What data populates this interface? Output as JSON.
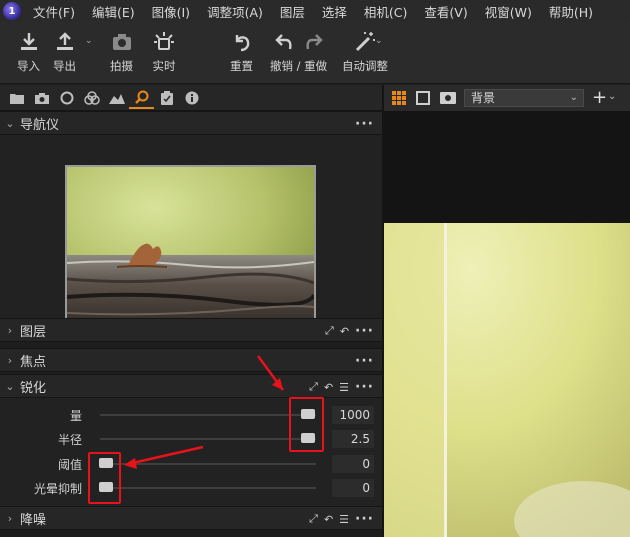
{
  "menu": {
    "items": [
      "文件(F)",
      "编辑(E)",
      "图像(I)",
      "调整项(A)",
      "图层",
      "选择",
      "相机(C)",
      "查看(V)",
      "视窗(W)",
      "帮助(H)"
    ]
  },
  "toolbar": {
    "import_label": "导入",
    "export_label": "导出",
    "capture_label": "拍摄",
    "live_label": "实时",
    "reset_label": "重置",
    "undo_redo_label": "撤销 / 重做",
    "auto_adjust_label": "自动调整"
  },
  "tabs": {
    "icons": [
      "folder-icon",
      "camera-icon",
      "circle-icon",
      "color-balance-icon",
      "exposure-icon",
      "details-icon",
      "metadata-icon",
      "info-icon"
    ],
    "active": "details-icon"
  },
  "panels": {
    "navigator_title": "导航仪",
    "layers_title": "图层",
    "focus_title": "焦点",
    "sharpening_title": "锐化",
    "noise_title": "降噪"
  },
  "sharpening": {
    "amount": {
      "label": "量",
      "value": "1000",
      "fraction": 1.0
    },
    "radius": {
      "label": "半径",
      "value": "2.5",
      "fraction": 1.0
    },
    "threshold": {
      "label": "阈值",
      "value": "0",
      "fraction": 0.0
    },
    "halo": {
      "label": "光晕抑制",
      "value": "0",
      "fraction": 0.0
    }
  },
  "viewer": {
    "layer_select_value": "背景"
  },
  "colors": {
    "accent": "#e8881a",
    "annotation_red": "#e8121b"
  }
}
